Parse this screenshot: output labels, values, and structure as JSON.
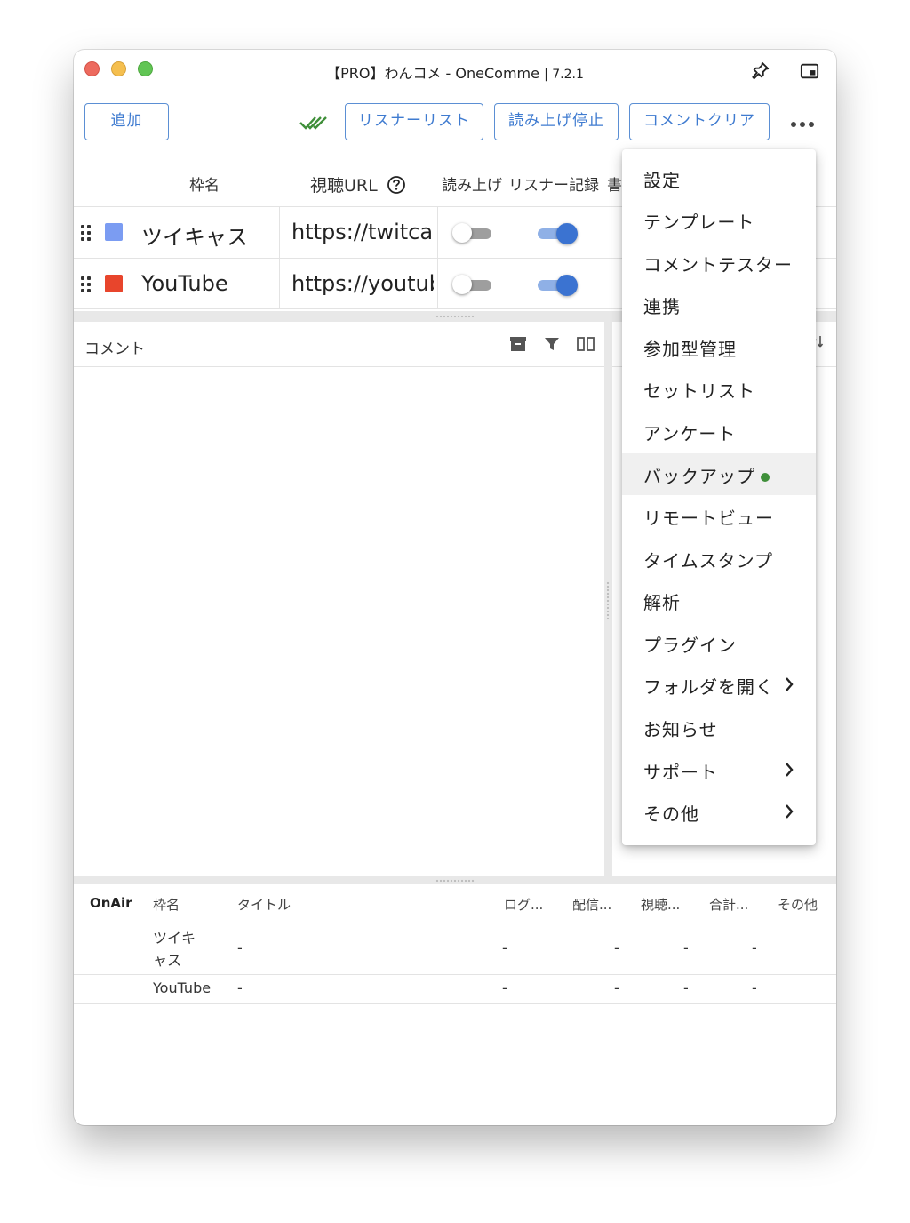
{
  "window": {
    "title": "【PRO】わんコメ - OneComme",
    "version": "| 7.2.1"
  },
  "toolbar": {
    "add_label": "追加",
    "listener_list_label": "リスナーリスト",
    "stop_reading_label": "読み上げ停止",
    "comment_clear_label": "コメントクリア"
  },
  "frames_table": {
    "headers": {
      "name": "枠名",
      "url": "視聴URL",
      "read": "読み上げ",
      "listener_record": "リスナー記録",
      "extra": "書"
    },
    "rows": [
      {
        "name": "ツイキャス",
        "url": "https://twitcas",
        "color": "#7b9cf2"
      },
      {
        "name": "YouTube",
        "url": "https://youtub",
        "color": "#e8452c"
      }
    ]
  },
  "comment_panel": {
    "label": "コメント"
  },
  "status_table": {
    "headers": [
      "OnAir",
      "枠名",
      "タイトル",
      "ログ...",
      "配信...",
      "視聴...",
      "合計...",
      "その他"
    ],
    "rows": [
      {
        "name_line1": "ツイキ",
        "name_line2": "ャス",
        "title": "-",
        "log": "-",
        "stream": "-",
        "views": "-",
        "total": "-"
      },
      {
        "name": "YouTube",
        "title": "-",
        "log": "-",
        "stream": "-",
        "views": "-",
        "total": "-"
      }
    ]
  },
  "menu": {
    "items": [
      {
        "label": "設定"
      },
      {
        "label": "テンプレート"
      },
      {
        "label": "コメントテスター"
      },
      {
        "label": "連携"
      },
      {
        "label": "参加型管理"
      },
      {
        "label": "セットリスト"
      },
      {
        "label": "アンケート"
      },
      {
        "label": "バックアップ",
        "badge": "green-dot",
        "highlighted": true
      },
      {
        "label": "リモートビュー"
      },
      {
        "label": "タイムスタンプ"
      },
      {
        "label": "解析"
      },
      {
        "label": "プラグイン"
      },
      {
        "label": "フォルダを開く",
        "submenu": true
      },
      {
        "label": "お知らせ"
      },
      {
        "label": "サポート",
        "submenu": true
      },
      {
        "label": "その他",
        "submenu": true
      }
    ]
  },
  "colors": {
    "accent": "#3f7bd0",
    "toggle_on": "#3b73d1",
    "check_green": "#3f8f3a"
  }
}
